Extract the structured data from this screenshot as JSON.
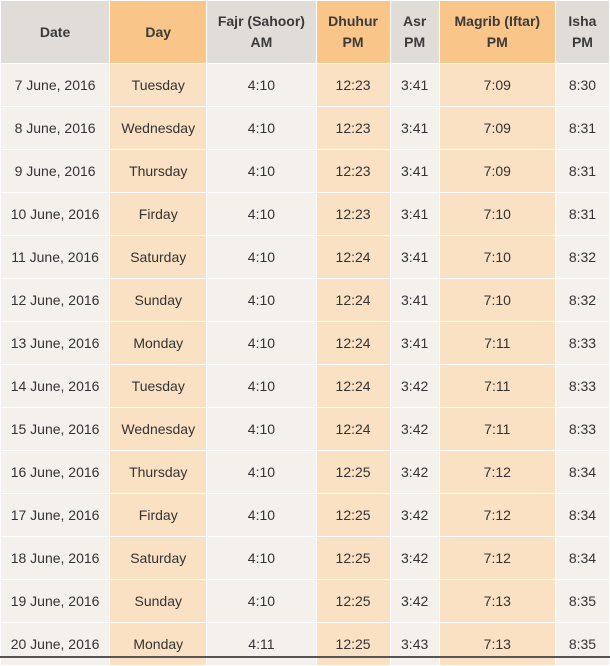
{
  "headers": {
    "date": "Date",
    "day": "Day",
    "fajr": [
      "Fajr (Sahoor)",
      "AM"
    ],
    "dhuhur": [
      "Dhuhur",
      "PM"
    ],
    "asr": [
      "Asr",
      "PM"
    ],
    "magrib": [
      "Magrib (Iftar)",
      "PM"
    ],
    "isha": [
      "Isha",
      "PM"
    ]
  },
  "rows": [
    {
      "date": "7 June, 2016",
      "day": "Tuesday",
      "fajr": "4:10",
      "dhuhur": "12:23",
      "asr": "3:41",
      "magrib": "7:09",
      "isha": "8:30"
    },
    {
      "date": "8 June, 2016",
      "day": "Wednesday",
      "fajr": "4:10",
      "dhuhur": "12:23",
      "asr": "3:41",
      "magrib": "7:09",
      "isha": "8:31"
    },
    {
      "date": "9 June, 2016",
      "day": "Thursday",
      "fajr": "4:10",
      "dhuhur": "12:23",
      "asr": "3:41",
      "magrib": "7:09",
      "isha": "8:31"
    },
    {
      "date": "10 June, 2016",
      "day": "Firday",
      "fajr": "4:10",
      "dhuhur": "12:23",
      "asr": "3:41",
      "magrib": "7:10",
      "isha": "8:31"
    },
    {
      "date": "11 June, 2016",
      "day": "Saturday",
      "fajr": "4:10",
      "dhuhur": "12:24",
      "asr": "3:41",
      "magrib": "7:10",
      "isha": "8:32"
    },
    {
      "date": "12 June, 2016",
      "day": "Sunday",
      "fajr": "4:10",
      "dhuhur": "12:24",
      "asr": "3:41",
      "magrib": "7:10",
      "isha": "8:32"
    },
    {
      "date": "13 June, 2016",
      "day": "Monday",
      "fajr": "4:10",
      "dhuhur": "12:24",
      "asr": "3:41",
      "magrib": "7:11",
      "isha": "8:33"
    },
    {
      "date": "14 June, 2016",
      "day": "Tuesday",
      "fajr": "4:10",
      "dhuhur": "12:24",
      "asr": "3:42",
      "magrib": "7:11",
      "isha": "8:33"
    },
    {
      "date": "15 June, 2016",
      "day": "Wednesday",
      "fajr": "4:10",
      "dhuhur": "12:24",
      "asr": "3:42",
      "magrib": "7:11",
      "isha": "8:33"
    },
    {
      "date": "16 June, 2016",
      "day": "Thursday",
      "fajr": "4:10",
      "dhuhur": "12:25",
      "asr": "3:42",
      "magrib": "7:12",
      "isha": "8:34"
    },
    {
      "date": "17 June, 2016",
      "day": "Firday",
      "fajr": "4:10",
      "dhuhur": "12:25",
      "asr": "3:42",
      "magrib": "7:12",
      "isha": "8:34"
    },
    {
      "date": "18 June, 2016",
      "day": "Saturday",
      "fajr": "4:10",
      "dhuhur": "12:25",
      "asr": "3:42",
      "magrib": "7:12",
      "isha": "8:34"
    },
    {
      "date": "19 June, 2016",
      "day": "Sunday",
      "fajr": "4:10",
      "dhuhur": "12:25",
      "asr": "3:42",
      "magrib": "7:13",
      "isha": "8:35"
    },
    {
      "date": "20 June, 2016",
      "day": "Monday",
      "fajr": "4:11",
      "dhuhur": "12:25",
      "asr": "3:43",
      "magrib": "7:13",
      "isha": "8:35"
    }
  ],
  "colors": {
    "header_gray": "#e0ddd8",
    "header_orange": "#f9c589",
    "cell_gray": "#f4f1ed",
    "cell_orange": "#fbe1c4"
  }
}
